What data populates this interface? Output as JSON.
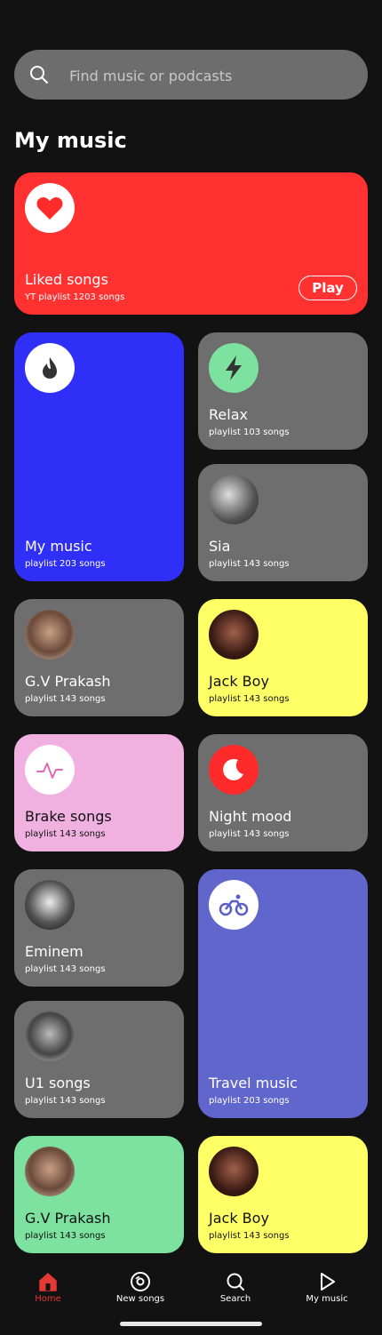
{
  "search": {
    "placeholder": "Find music or podcasts"
  },
  "section_title": "My music",
  "liked": {
    "title": "Liked songs",
    "subtitle": "YT playlist 1203 songs",
    "play_label": "Play"
  },
  "cards": {
    "mymusic": {
      "title": "My music",
      "subtitle": "playlist 203 songs"
    },
    "relax": {
      "title": "Relax",
      "subtitle": "playlist 103 songs"
    },
    "sia": {
      "title": "Sia",
      "subtitle": "playlist 143 songs"
    },
    "gvprakash": {
      "title": "G.V Prakash",
      "subtitle": "playlist 143 songs"
    },
    "jackboy": {
      "title": "Jack Boy",
      "subtitle": "playlist 143 songs"
    },
    "brake": {
      "title": "Brake songs",
      "subtitle": "playlist 143 songs"
    },
    "night": {
      "title": "Night mood",
      "subtitle": "playlist 143 songs"
    },
    "eminem": {
      "title": "Eminem",
      "subtitle": "playlist 143 songs"
    },
    "u1": {
      "title": "U1 songs",
      "subtitle": "playlist 143 songs"
    },
    "travel": {
      "title": "Travel music",
      "subtitle": "playlist 203 songs"
    },
    "gvprakash2": {
      "title": "G.V Prakash",
      "subtitle": "playlist 143 songs"
    },
    "jackboy2": {
      "title": "Jack Boy",
      "subtitle": "playlist 143 songs"
    }
  },
  "nav": {
    "home": "Home",
    "new_songs": "New songs",
    "search": "Search",
    "my_music": "My music"
  },
  "colors": {
    "liked": "#ff3131",
    "blue": "#2f2ff8",
    "grey": "#6e6e6e",
    "yellow": "#ffff66",
    "pink": "#f0b0e0",
    "violet": "#6166cc",
    "green": "#7de2a0",
    "accent": "#e53935"
  }
}
